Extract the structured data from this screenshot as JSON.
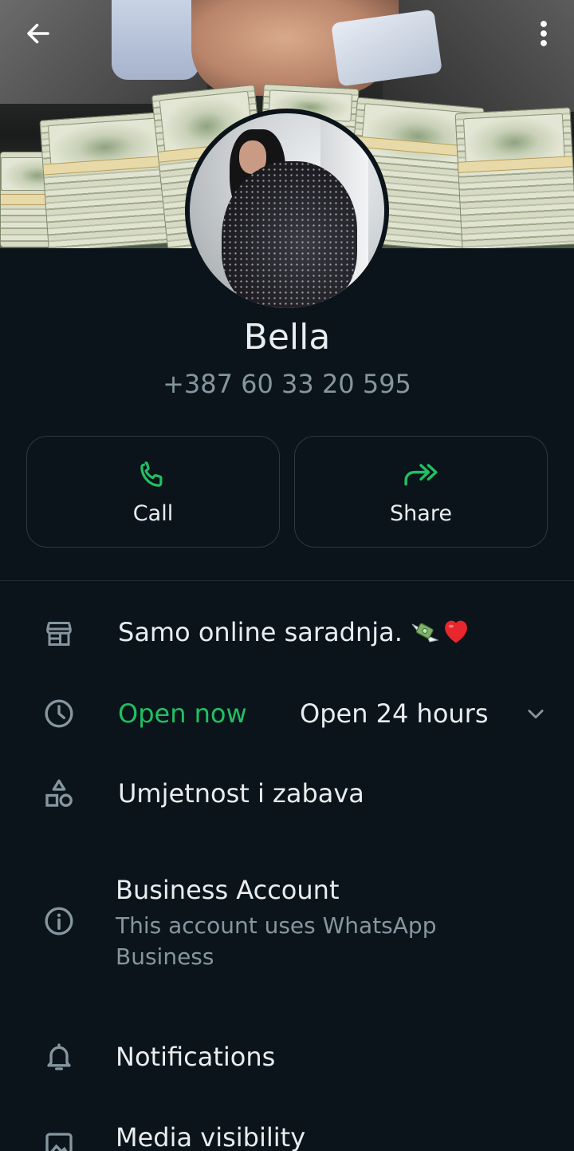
{
  "header": {
    "back_icon": "arrow-left-icon",
    "more_icon": "more-vertical-icon"
  },
  "profile": {
    "name": "Bella",
    "phone": "+387 60 33 20 595"
  },
  "actions": [
    {
      "label": "Call",
      "icon": "phone-icon"
    },
    {
      "label": "Share",
      "icon": "share-forward-icon"
    }
  ],
  "about": {
    "text": "Samo online saradnja.",
    "emojis": [
      "money-with-wings",
      "red-heart"
    ]
  },
  "hours": {
    "status": "Open now",
    "schedule": "Open 24 hours"
  },
  "category": {
    "text": "Umjetnost i zabava"
  },
  "business": {
    "title": "Business Account",
    "subtitle": "This account uses WhatsApp Business"
  },
  "settings": {
    "notifications": "Notifications",
    "media_visibility": "Media visibility"
  },
  "colors": {
    "background": "#0b141a",
    "accent_green": "#21c063",
    "secondary_text": "#8696a0",
    "border": "#2a3942"
  }
}
